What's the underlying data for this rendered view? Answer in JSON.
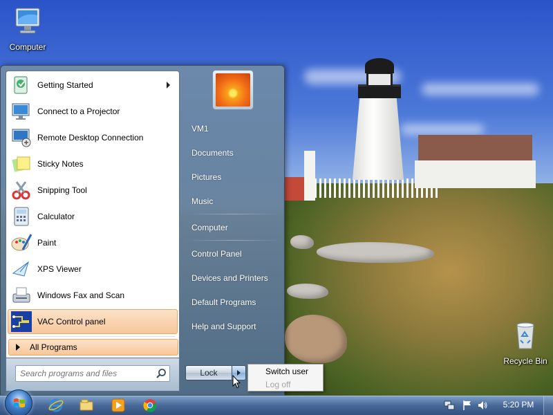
{
  "desktop": {
    "computer_label": "Computer",
    "recycle_bin_label": "Recycle Bin"
  },
  "start_menu": {
    "programs": [
      {
        "label": "Getting Started",
        "icon": "getting-started-icon",
        "has_submenu": true
      },
      {
        "label": "Connect to a Projector",
        "icon": "projector-icon"
      },
      {
        "label": "Remote Desktop Connection",
        "icon": "remote-desktop-icon"
      },
      {
        "label": "Sticky Notes",
        "icon": "sticky-notes-icon"
      },
      {
        "label": "Snipping Tool",
        "icon": "snipping-tool-icon"
      },
      {
        "label": "Calculator",
        "icon": "calculator-icon"
      },
      {
        "label": "Paint",
        "icon": "paint-icon"
      },
      {
        "label": "XPS Viewer",
        "icon": "xps-viewer-icon"
      },
      {
        "label": "Windows Fax and Scan",
        "icon": "fax-scan-icon"
      },
      {
        "label": "VAC Control panel",
        "icon": "vac-control-panel-icon",
        "highlighted": true
      }
    ],
    "all_programs_label": "All Programs",
    "search_placeholder": "Search programs and files",
    "right_links": [
      "VM1",
      "Documents",
      "Pictures",
      "Music",
      "Computer",
      "Control Panel",
      "Devices and Printers",
      "Default Programs",
      "Help and Support"
    ],
    "lock_label": "Lock",
    "power_submenu": {
      "items": [
        {
          "label": "Switch user",
          "enabled": true
        },
        {
          "label": "Log off",
          "enabled": false
        }
      ]
    }
  },
  "taskbar": {
    "pinned": [
      "internet-explorer-icon",
      "windows-explorer-icon",
      "media-player-icon",
      "chrome-icon"
    ],
    "tray_icons": [
      "network-icon",
      "action-center-flag-icon",
      "volume-icon"
    ],
    "clock": "5:20 PM"
  },
  "colors": {
    "highlight": "#f7c79b",
    "taskbar": "#4868a0",
    "start_menu_glass": "#708ca8"
  }
}
